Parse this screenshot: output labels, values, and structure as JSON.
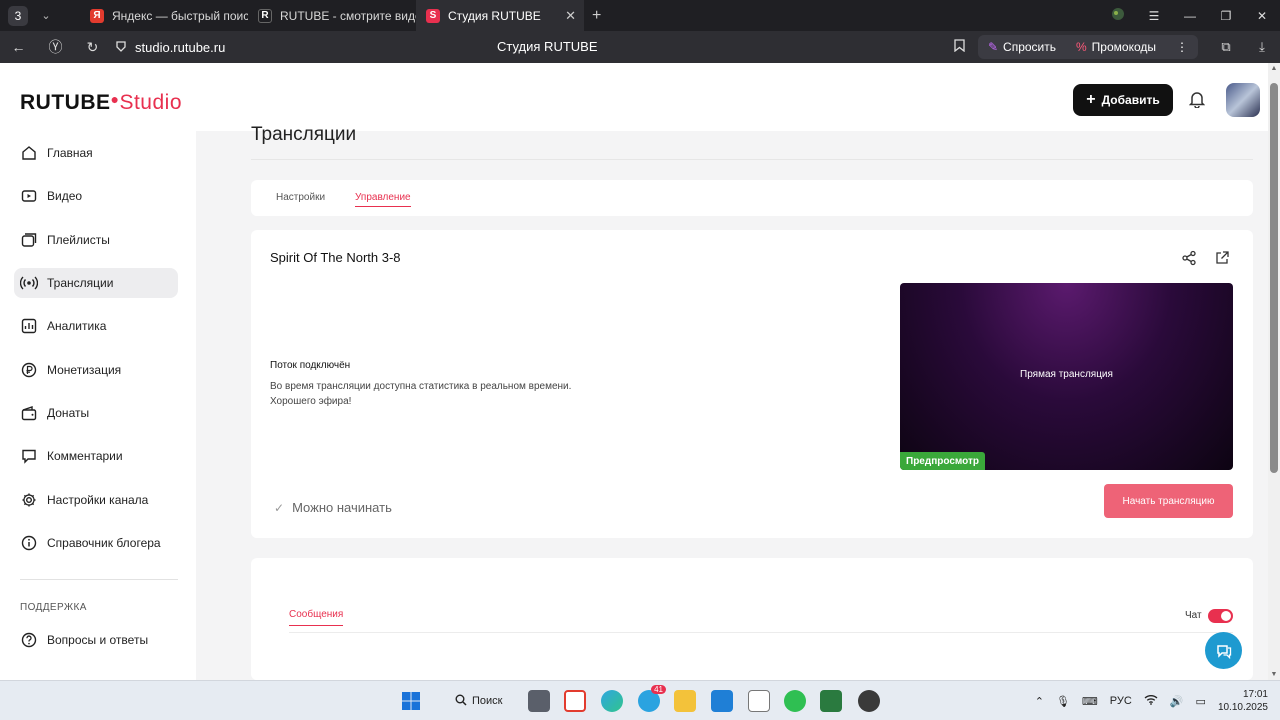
{
  "browser": {
    "tab_count": "3",
    "tabs": [
      {
        "label": "Яндекс — быстрый поиск",
        "fav_color": "#e23b2e",
        "fav_glyph": "Я"
      },
      {
        "label": "RUTUBE - смотрите виде",
        "fav_color": "#1f1f23",
        "fav_glyph": "R"
      },
      {
        "label": "Студия RUTUBE",
        "fav_color": "#e8304f",
        "fav_glyph": "S"
      }
    ],
    "url": "studio.rutube.ru",
    "page_title": "Студия RUTUBE",
    "ask_label": "Спросить",
    "promo_label": "Промокоды"
  },
  "header": {
    "logo_main": "RUTUBE",
    "logo_studio": "Studio",
    "add_label": "Добавить"
  },
  "sidebar": {
    "items": [
      {
        "label": "Главная",
        "icon": "home-icon"
      },
      {
        "label": "Видео",
        "icon": "video-icon"
      },
      {
        "label": "Плейлисты",
        "icon": "playlist-icon"
      },
      {
        "label": "Трансляции",
        "icon": "broadcast-icon",
        "active": true
      },
      {
        "label": "Аналитика",
        "icon": "analytics-icon"
      },
      {
        "label": "Монетизация",
        "icon": "ruble-icon"
      },
      {
        "label": "Донаты",
        "icon": "wallet-icon"
      },
      {
        "label": "Комментарии",
        "icon": "comment-icon"
      },
      {
        "label": "Настройки канала",
        "icon": "gear-icon"
      },
      {
        "label": "Справочник блогера",
        "icon": "info-icon"
      }
    ],
    "support_heading": "ПОДДЕРЖКА",
    "support_items": [
      {
        "label": "Вопросы и ответы",
        "icon": "question-icon"
      }
    ]
  },
  "main": {
    "heading": "Трансляции",
    "tabs": [
      {
        "label": "Настройки"
      },
      {
        "label": "Управление",
        "active": true
      }
    ],
    "stream": {
      "title": "Spirit Of The North 3-8",
      "status_title": "Поток подключён",
      "status_line1": "Во время трансляции доступна статистика в реальном времени.",
      "status_line2": "Хорошего эфира!",
      "preview_label": "Прямая трансляция",
      "preview_badge": "Предпросмотр",
      "ready_label": "Можно начинать",
      "start_label": "Начать трансляцию"
    },
    "chat": {
      "tab_label": "Сообщения",
      "toggle_label": "Чат",
      "toggle_on": true
    }
  },
  "taskbar": {
    "search_label": "Поиск",
    "telegram_badge": "41",
    "lang": "РУС",
    "time": "17:01",
    "date": "10.10.2025"
  },
  "colors": {
    "accent": "#e8304f",
    "start_button": "#ee6377",
    "preview_badge": "#3aa83a",
    "help_button": "#1e9ad0"
  }
}
